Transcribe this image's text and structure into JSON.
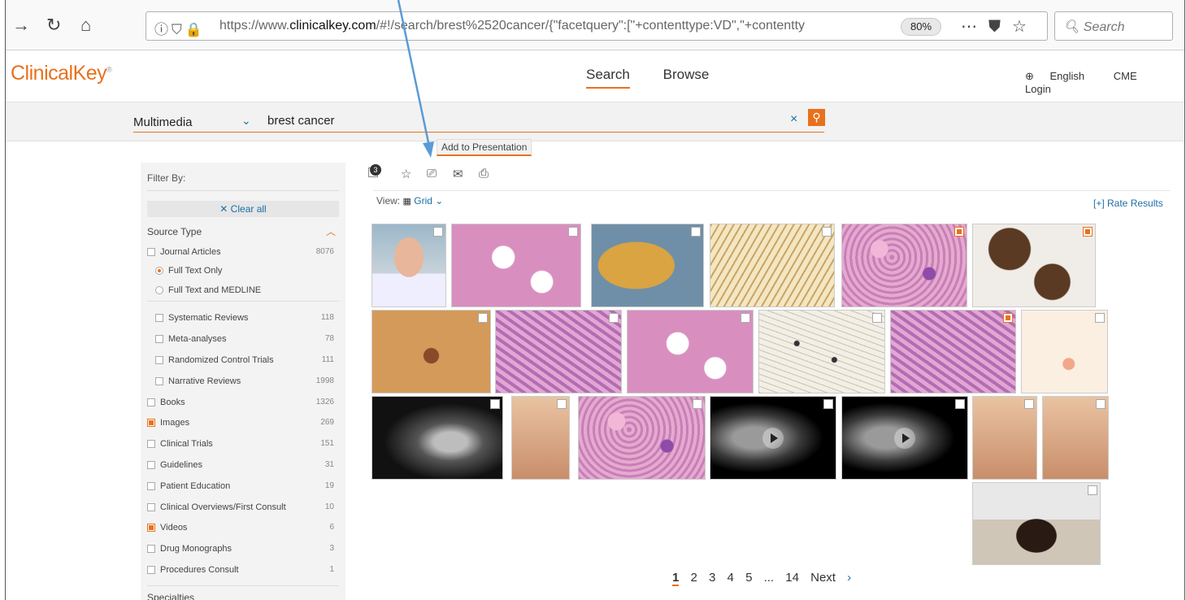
{
  "browser": {
    "url_prefix": "https://www.",
    "url_domain": "clinicalkey.com",
    "url_rest": "/#!/search/brest%2520cancer/{\"facetquery\":[\"+contenttype:VD\",\"+contentty",
    "zoom": "80%",
    "search_placeholder": "Search"
  },
  "header": {
    "logo": "ClinicalKey",
    "nav": [
      "Search",
      "Browse"
    ],
    "language": "English",
    "cme": "CME",
    "login": "Login"
  },
  "search": {
    "type": "Multimedia",
    "query": "brest cancer",
    "clear": "×"
  },
  "filters": {
    "title": "Filter By:",
    "clear_all": "✕ Clear all",
    "section": "Source Type",
    "items": [
      {
        "label": "Journal Articles",
        "count": "8076",
        "kind": "box",
        "checked": false
      },
      {
        "label": "Full Text Only",
        "count": "",
        "kind": "radio",
        "checked": true
      },
      {
        "label": "Full Text and MEDLINE",
        "count": "",
        "kind": "radio",
        "checked": false
      },
      {
        "label": "Systematic Reviews",
        "count": "118",
        "kind": "sub",
        "checked": false
      },
      {
        "label": "Meta-analyses",
        "count": "78",
        "kind": "sub",
        "checked": false
      },
      {
        "label": "Randomized Control Trials",
        "count": "111",
        "kind": "sub",
        "checked": false
      },
      {
        "label": "Narrative Reviews",
        "count": "1998",
        "kind": "sub",
        "checked": false
      },
      {
        "label": "Books",
        "count": "1326",
        "kind": "box",
        "checked": false
      },
      {
        "label": "Images",
        "count": "269",
        "kind": "box",
        "checked": true
      },
      {
        "label": "Clinical Trials",
        "count": "151",
        "kind": "box",
        "checked": false
      },
      {
        "label": "Guidelines",
        "count": "31",
        "kind": "box",
        "checked": false
      },
      {
        "label": "Patient Education",
        "count": "19",
        "kind": "box",
        "checked": false
      },
      {
        "label": "Clinical Overviews/First Consult",
        "count": "10",
        "kind": "box",
        "checked": false
      },
      {
        "label": "Videos",
        "count": "6",
        "kind": "box",
        "checked": true
      },
      {
        "label": "Drug Monographs",
        "count": "3",
        "kind": "box",
        "checked": false
      },
      {
        "label": "Procedures Consult",
        "count": "1",
        "kind": "box",
        "checked": false
      }
    ],
    "next_section": "Specialties"
  },
  "toolbar": {
    "selected_count": "3",
    "tooltip": "Add to Presentation"
  },
  "view": {
    "label": "View:",
    "mode": "Grid",
    "rate": "[+] Rate Results"
  },
  "pagination": {
    "pages": [
      "1",
      "2",
      "3",
      "4",
      "5",
      "...",
      "14"
    ],
    "next": "Next"
  },
  "colors": {
    "accent": "#e9711c",
    "link": "#1b6fa8",
    "arrow": "#5b9bd5"
  }
}
